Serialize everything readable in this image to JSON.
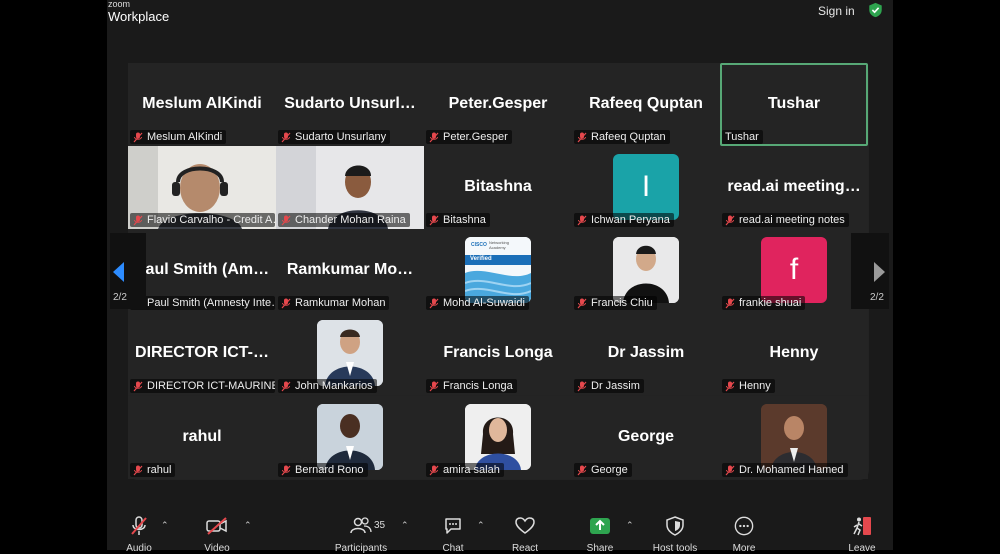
{
  "app": {
    "brand_small": "zoom",
    "brand": "Workplace",
    "signin": "Sign in"
  },
  "pagination": {
    "left": "2/2",
    "right": "2/2"
  },
  "tiles": [
    {
      "big": "Meslum AlKindi",
      "label": "Meslum AlKindi"
    },
    {
      "big": "Sudarto  Unsurl…",
      "label": "Sudarto Unsurlany"
    },
    {
      "big": "Peter.Gesper",
      "label": "Peter.Gesper"
    },
    {
      "big": "Rafeeq Quptan",
      "label": "Rafeeq Quptan"
    },
    {
      "big": "Tushar",
      "label": "Tushar"
    },
    {
      "big": "",
      "label": "Flavio Carvalho - Credit A…"
    },
    {
      "big": "",
      "label": "Chander Mohan Raina"
    },
    {
      "big": "Bitashna",
      "label": "Bitashna"
    },
    {
      "big": "",
      "label": "Ichwan Peryana",
      "letter": "I"
    },
    {
      "big": "read.ai  meeting…",
      "label": "read.ai meeting notes"
    },
    {
      "big": "Paul  Smith  (Am…",
      "label": "Paul Smith (Amnesty Inte…"
    },
    {
      "big": "Ramkumar  Mo…",
      "label": "Ramkumar Mohan"
    },
    {
      "big": "",
      "label": "Mohd Al-Suwaidi"
    },
    {
      "big": "",
      "label": "Francis Chiu"
    },
    {
      "big": "",
      "label": "frankie shuai",
      "letter": "f"
    },
    {
      "big": "DIRECTOR  ICT-…",
      "label": "DIRECTOR ICT-MAURINE …"
    },
    {
      "big": "",
      "label": "John Mankarios"
    },
    {
      "big": "Francis Longa",
      "label": "Francis Longa"
    },
    {
      "big": "Dr Jassim",
      "label": "Dr Jassim"
    },
    {
      "big": "Henny",
      "label": "Henny"
    },
    {
      "big": "rahul",
      "label": "rahul"
    },
    {
      "big": "",
      "label": "Bernard Rono"
    },
    {
      "big": "",
      "label": "amira salah"
    },
    {
      "big": "George",
      "label": "George"
    },
    {
      "big": "",
      "label": "Dr. Mohamed Hamed"
    }
  ],
  "cisco_badge": {
    "brand": "CISCO",
    "line1": "Networking",
    "line2": "Academy",
    "status": "Verified"
  },
  "toolbar": {
    "audio": "Audio",
    "video": "Video",
    "participants": "Participants",
    "participants_count": "35",
    "chat": "Chat",
    "react": "React",
    "share": "Share",
    "host_tools": "Host tools",
    "more": "More",
    "leave": "Leave"
  },
  "colors": {
    "active_speaker": "#57a876",
    "teal_avatar": "#1aa3a8",
    "pink_avatar": "#e0245e",
    "share_green": "#2ea44f",
    "leave_red": "#e5484d",
    "mic_off_red": "#e5484d"
  }
}
